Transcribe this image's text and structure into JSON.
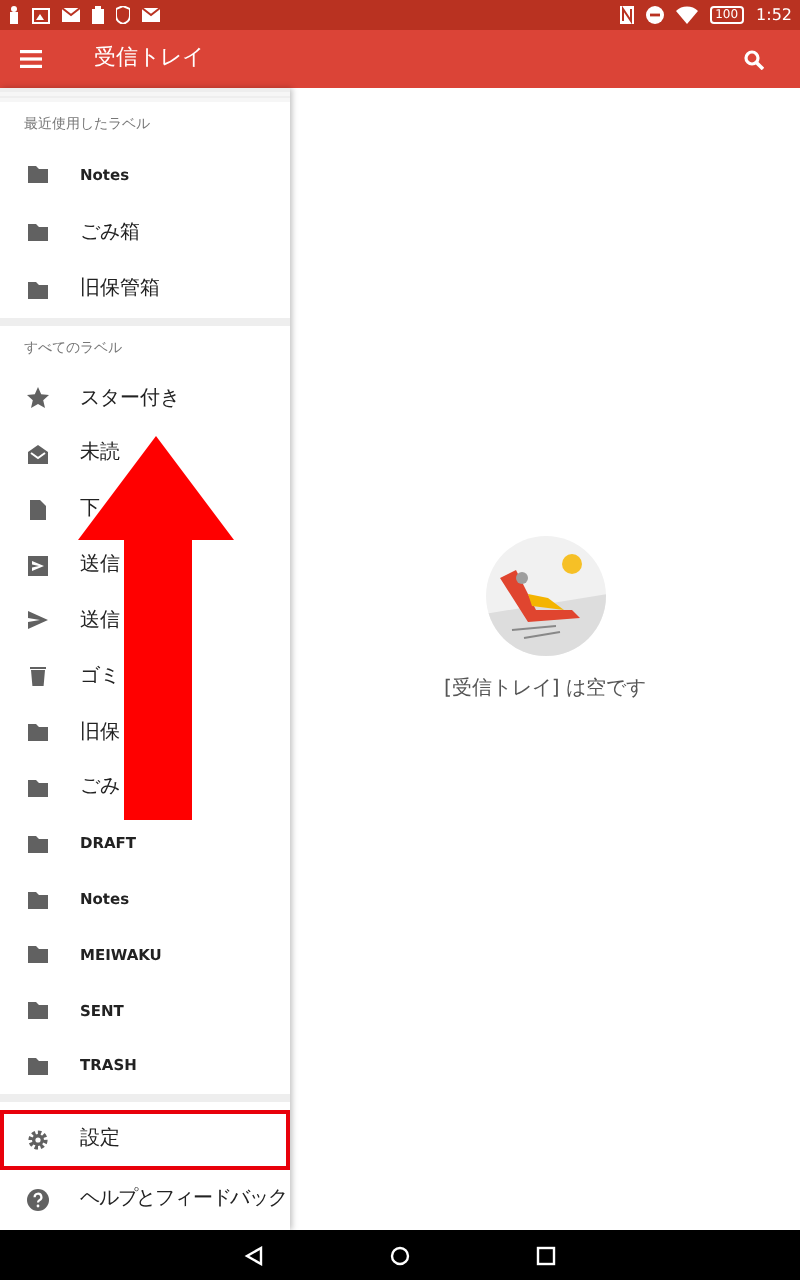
{
  "status_bar": {
    "battery": "100",
    "time": "1:52"
  },
  "app_bar": {
    "title": "受信トレイ"
  },
  "drawer": {
    "sections": [
      {
        "header": "最近使用したラベル",
        "items": [
          {
            "kind": "folder",
            "label": "Notes"
          },
          {
            "kind": "folder",
            "label": "ごみ箱"
          },
          {
            "kind": "folder",
            "label": "旧保管箱"
          }
        ]
      },
      {
        "header": "すべてのラベル",
        "items": [
          {
            "kind": "star",
            "label": "スター付き"
          },
          {
            "kind": "unread",
            "label": "未読"
          },
          {
            "kind": "draft",
            "label": "下"
          },
          {
            "kind": "outbox",
            "label": "送信"
          },
          {
            "kind": "send",
            "label": "送信"
          },
          {
            "kind": "trash",
            "label": "ゴミ"
          },
          {
            "kind": "folder",
            "label": "旧保"
          },
          {
            "kind": "folder",
            "label": "ごみ"
          },
          {
            "kind": "folder",
            "label": "DRAFT"
          },
          {
            "kind": "folder",
            "label": "Notes"
          },
          {
            "kind": "folder",
            "label": "MEIWAKU"
          },
          {
            "kind": "folder",
            "label": "SENT"
          },
          {
            "kind": "folder",
            "label": "TRASH"
          }
        ]
      }
    ],
    "footer_items": [
      {
        "kind": "gear",
        "label": "設定",
        "highlighted": true
      },
      {
        "kind": "help",
        "label": "ヘルプとフィードバック",
        "highlighted": false
      }
    ]
  },
  "empty_state": {
    "message": "[受信トレイ] は空です"
  }
}
